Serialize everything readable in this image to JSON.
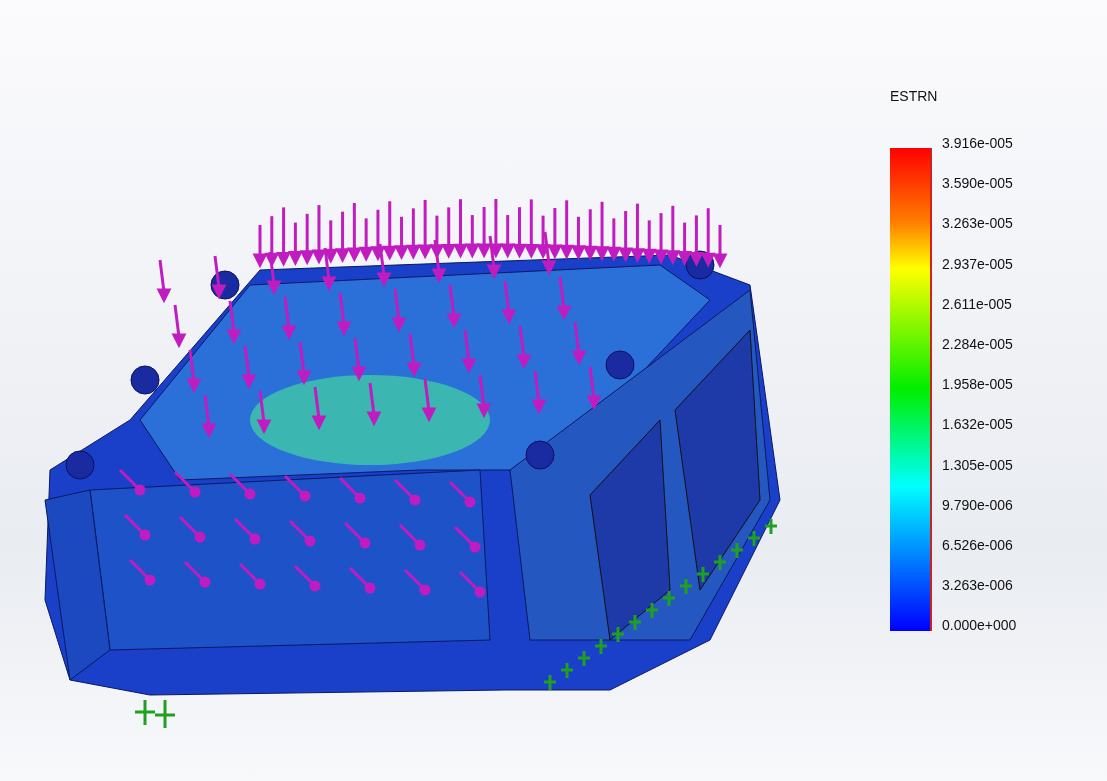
{
  "legend": {
    "title": "ESTRN",
    "labels": [
      "3.916e-005",
      "3.590e-005",
      "3.263e-005",
      "2.937e-005",
      "2.611e-005",
      "2.284e-005",
      "1.958e-005",
      "1.632e-005",
      "1.305e-005",
      "9.790e-006",
      "6.526e-006",
      "3.263e-006",
      "0.000e+000"
    ]
  }
}
